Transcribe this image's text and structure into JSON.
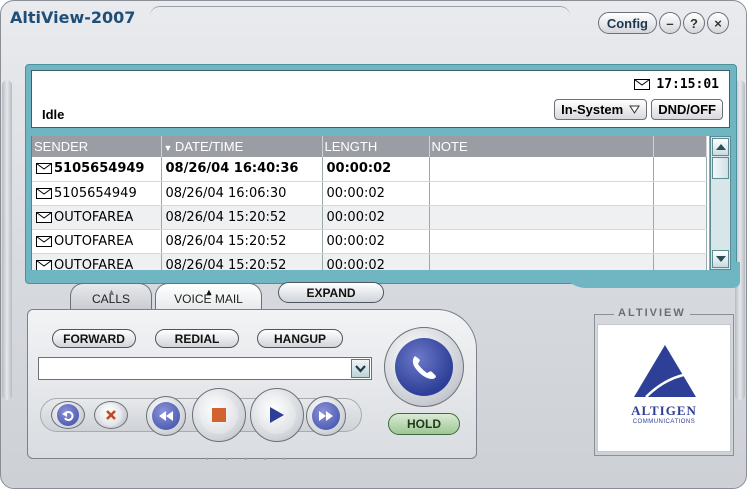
{
  "window": {
    "title": "AltiView-2007",
    "config_label": "Config",
    "minimize_glyph": "–",
    "help_glyph": "?",
    "close_glyph": "×"
  },
  "status": {
    "time": "17:15:01",
    "state": "Idle",
    "presence_label": "In-System",
    "dnd_label": "DND/OFF"
  },
  "table": {
    "columns": [
      "SENDER",
      "DATE/TIME",
      "LENGTH",
      "NOTE"
    ],
    "sort_column": "DATE/TIME",
    "rows": [
      {
        "sender": "5105654949",
        "datetime": "08/26/04 16:40:36",
        "length": "00:00:02",
        "note": "",
        "unread": true
      },
      {
        "sender": "5105654949",
        "datetime": "08/26/04 16:06:30",
        "length": "00:00:02",
        "note": "",
        "unread": false
      },
      {
        "sender": "OUTOFAREA",
        "datetime": "08/26/04 15:20:52",
        "length": "00:00:02",
        "note": "",
        "unread": false
      },
      {
        "sender": "OUTOFAREA",
        "datetime": "08/26/04 15:20:52",
        "length": "00:00:02",
        "note": "",
        "unread": false
      },
      {
        "sender": "OUTOFAREA",
        "datetime": "08/26/04 15:20:52",
        "length": "00:00:02",
        "note": "",
        "unread": false
      }
    ]
  },
  "tabs": {
    "calls": "CALLS",
    "voicemail": "VOICE MAIL",
    "expand": "EXPAND"
  },
  "controls": {
    "forward": "FORWARD",
    "redial": "REDIAL",
    "hangup": "HANGUP",
    "hold": "HOLD",
    "dial_value": ""
  },
  "logo": {
    "caption": "ALTIVIEW",
    "brand": "ALTIGEN",
    "sub": "COMMUNICATIONS"
  },
  "colors": {
    "accent_teal": "#6fb6c2",
    "brand_blue": "#2d3f97",
    "stop_orange": "#d2622e",
    "hold_green": "#9ec595"
  },
  "icons": [
    "envelope-icon",
    "phone-icon",
    "undo-icon",
    "delete-icon",
    "rewind-icon",
    "stop-icon",
    "play-icon",
    "fast-forward-icon",
    "chevron-down-icon"
  ]
}
